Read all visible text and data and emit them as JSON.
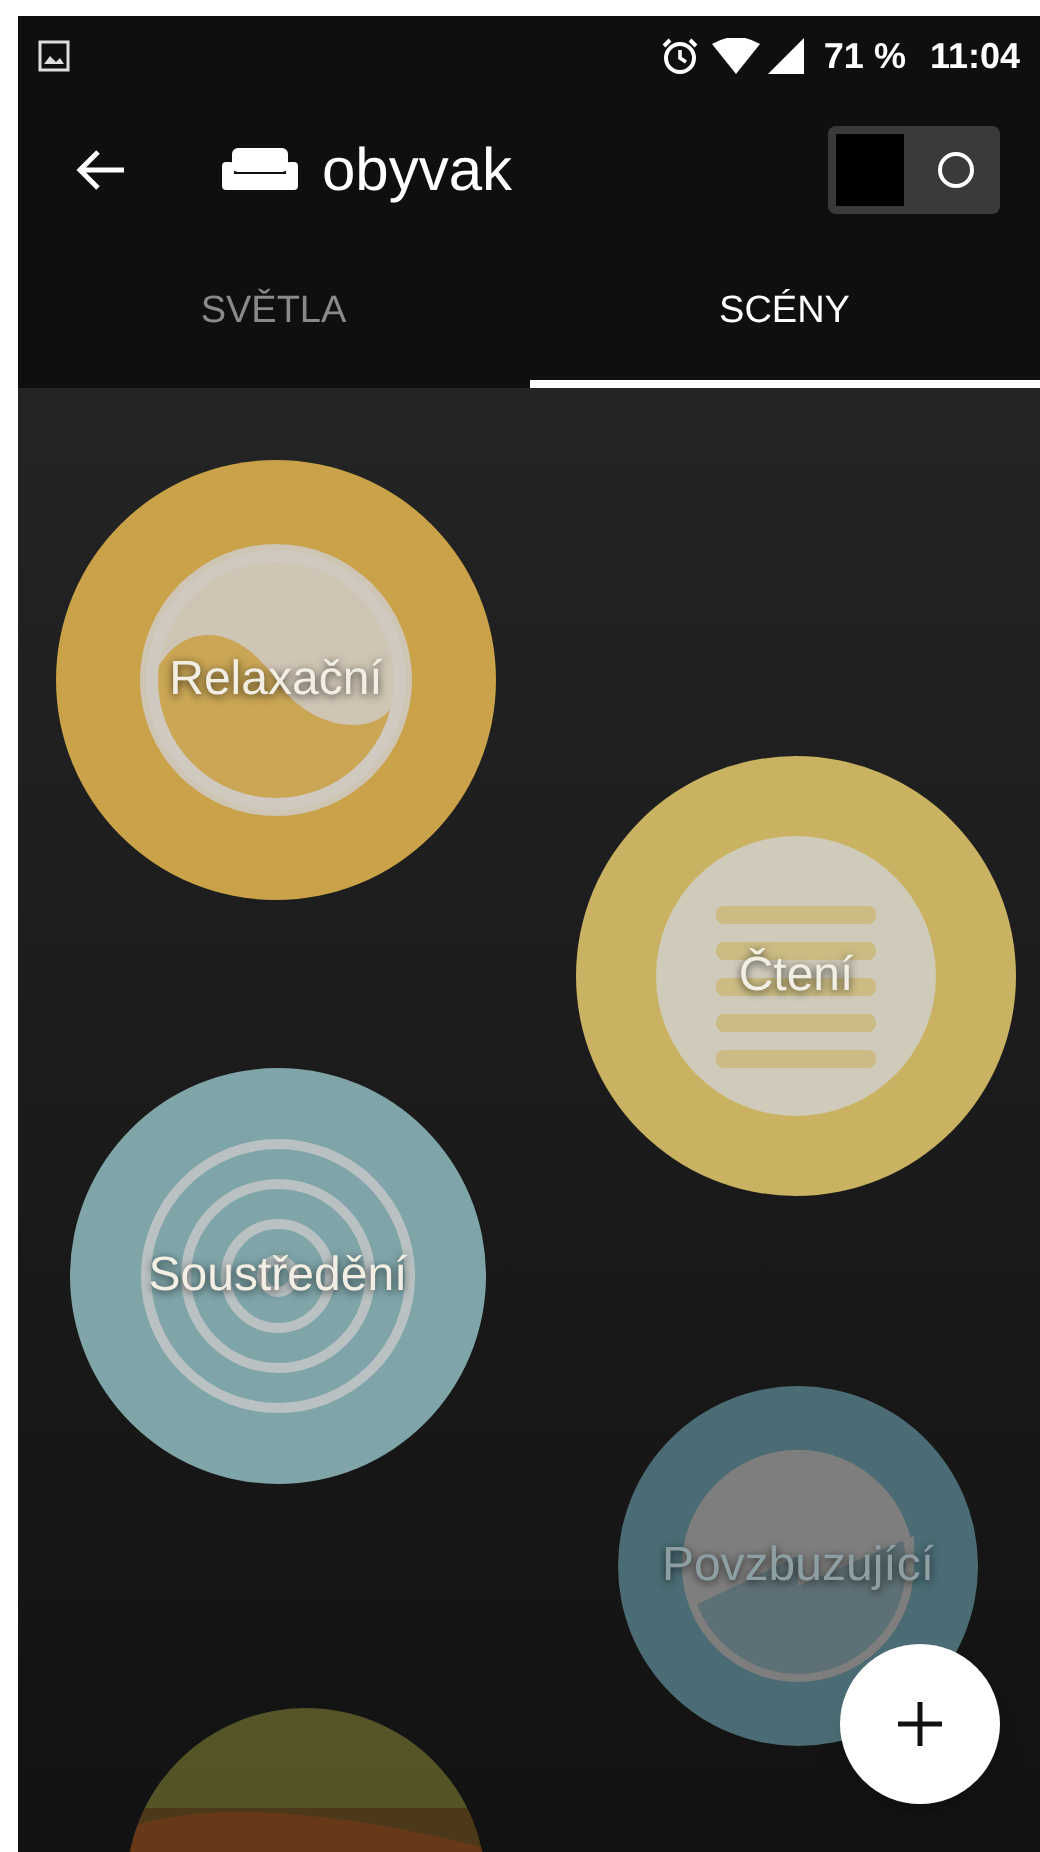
{
  "status_bar": {
    "battery": "71 %",
    "time": "11:04"
  },
  "app_bar": {
    "title": "obyvak",
    "toggle": {
      "on": false
    }
  },
  "tabs": [
    {
      "label": "SVĚTLA",
      "selected": false
    },
    {
      "label": "SCÉNY",
      "selected": true
    }
  ],
  "scenes": [
    {
      "name": "Relaxační",
      "kind": "yin",
      "color": "#c9a24a"
    },
    {
      "name": "Čtení",
      "kind": "lines",
      "color": "#c9b261"
    },
    {
      "name": "Soustředění",
      "kind": "spiral",
      "color": "#7fa5a9"
    },
    {
      "name": "Povzbuzující",
      "kind": "bolt",
      "color": "#4b6c74"
    },
    {
      "kind": "picture"
    }
  ]
}
